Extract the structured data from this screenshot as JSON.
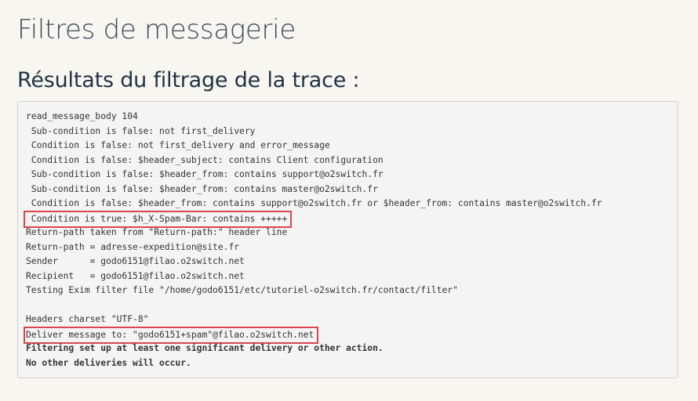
{
  "page": {
    "title": "Filtres de messagerie",
    "section_title": "Résultats du filtrage de la trace :"
  },
  "trace": {
    "lines": [
      {
        "text": "read_message_body 104",
        "highlight": false,
        "bold": false
      },
      {
        "text": " Sub-condition is false: not first_delivery",
        "highlight": false,
        "bold": false
      },
      {
        "text": " Condition is false: not first_delivery and error_message",
        "highlight": false,
        "bold": false
      },
      {
        "text": " Condition is false: $header_subject: contains Client configuration",
        "highlight": false,
        "bold": false
      },
      {
        "text": " Sub-condition is false: $header_from: contains support@o2switch.fr",
        "highlight": false,
        "bold": false
      },
      {
        "text": " Sub-condition is false: $header_from: contains master@o2switch.fr",
        "highlight": false,
        "bold": false
      },
      {
        "text": " Condition is false: $header_from: contains support@o2switch.fr or $header_from: contains master@o2switch.fr",
        "highlight": false,
        "bold": false
      },
      {
        "text": " Condition is true: $h_X-Spam-Bar: contains +++++",
        "highlight": true,
        "bold": false
      },
      {
        "text": "Return-path taken from \"Return-path:\" header line",
        "highlight": false,
        "bold": false
      },
      {
        "text": "Return-path = adresse-expedition@site.fr",
        "highlight": false,
        "bold": false
      },
      {
        "text": "Sender      = godo6151@filao.o2switch.net",
        "highlight": false,
        "bold": false
      },
      {
        "text": "Recipient   = godo6151@filao.o2switch.net",
        "highlight": false,
        "bold": false
      },
      {
        "text": "Testing Exim filter file \"/home/godo6151/etc/tutoriel-o2switch.fr/contact/filter\"",
        "highlight": false,
        "bold": false
      },
      {
        "text": "",
        "highlight": false,
        "bold": false
      },
      {
        "text": "Headers charset \"UTF-8\"",
        "highlight": false,
        "bold": false
      },
      {
        "text": "Deliver message to: \"godo6151+spam\"@filao.o2switch.net",
        "highlight": true,
        "bold": false
      },
      {
        "text": "Filtering set up at least one significant delivery or other action.",
        "highlight": false,
        "bold": true
      },
      {
        "text": "No other deliveries will occur.",
        "highlight": false,
        "bold": true
      }
    ],
    "highlight_color": "#d9464c"
  }
}
